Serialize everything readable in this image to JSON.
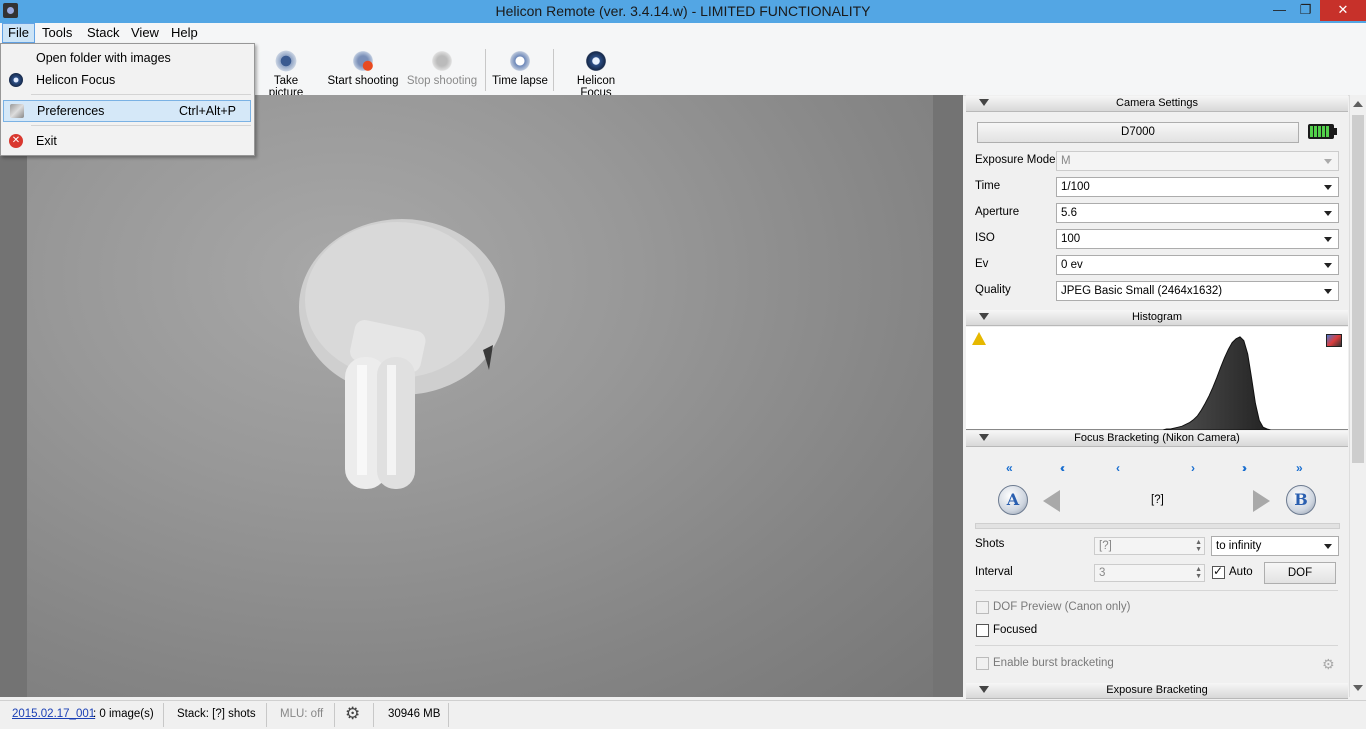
{
  "window": {
    "title": "Helicon Remote (ver. 3.4.14.w) - LIMITED FUNCTIONALITY",
    "minimize": "—",
    "maximize": "❐",
    "close": "✕"
  },
  "menu": {
    "file": "File",
    "tools": "Tools",
    "stack": "Stack",
    "view": "View",
    "help": "Help"
  },
  "file_menu": {
    "open_folder": "Open folder with images",
    "helicon_focus": "Helicon Focus",
    "preferences": "Preferences",
    "preferences_shortcut": "Ctrl+Alt+P",
    "exit": "Exit"
  },
  "toolbar": {
    "take_picture": "Take picture",
    "start_shooting": "Start shooting",
    "stop_shooting": "Stop shooting",
    "time_lapse": "Time lapse",
    "helicon_focus": "Helicon Focus"
  },
  "camera_settings": {
    "header": "Camera Settings",
    "camera": "D7000",
    "exposure_mode_label": "Exposure Mode",
    "exposure_mode": "M",
    "time_label": "Time",
    "time": "1/100",
    "aperture_label": "Aperture",
    "aperture": "5.6",
    "iso_label": "ISO",
    "iso": "100",
    "ev_label": "Ev",
    "ev": "0 ev",
    "quality_label": "Quality",
    "quality": "JPEG Basic Small (2464x1632)"
  },
  "histogram": {
    "header": "Histogram",
    "values": [
      0,
      0,
      0,
      0,
      0,
      0,
      0,
      0,
      0,
      0,
      0,
      0,
      0,
      0,
      0,
      0,
      0,
      0,
      0,
      0,
      0,
      0,
      0,
      0,
      0,
      0,
      0,
      0,
      0,
      0,
      0,
      0,
      0,
      0,
      0,
      0,
      0,
      0,
      0,
      0,
      0,
      0,
      0,
      0,
      0,
      0,
      0,
      0,
      0,
      0,
      0,
      0,
      1,
      1,
      2,
      3,
      4,
      6,
      8,
      11,
      15,
      21,
      28,
      36,
      45,
      55,
      66,
      76,
      85,
      92,
      96,
      98,
      94,
      80,
      55,
      28,
      10,
      3,
      1,
      0,
      0,
      0,
      0,
      0,
      0,
      0,
      0,
      0,
      0,
      0,
      0,
      0,
      0,
      0,
      0,
      0,
      0,
      0,
      0,
      0
    ],
    "warning_icon": "warning-icon"
  },
  "focus_bracketing": {
    "header": "Focus Bracketing (Nikon Camera)",
    "nav": [
      "«",
      "‹‹",
      "‹",
      "›",
      "››",
      "»"
    ],
    "point_a": "A",
    "point_b": "B",
    "position": "[?]",
    "shots_label": "Shots",
    "shots": "[?]",
    "shots_mode": "to infinity",
    "interval_label": "Interval",
    "interval": "3",
    "auto_label": "Auto",
    "dof_button": "DOF",
    "dof_preview_label": "DOF Preview (Canon only)",
    "focused_label": "Focused",
    "burst_label": "Enable burst bracketing"
  },
  "exposure_bracketing": {
    "header": "Exposure Bracketing"
  },
  "status": {
    "folder": "2015.02.17_001",
    "images": ": 0 image(s)",
    "stack": "Stack: [?] shots",
    "mlu": "MLU: off",
    "memory": "30946 MB"
  }
}
